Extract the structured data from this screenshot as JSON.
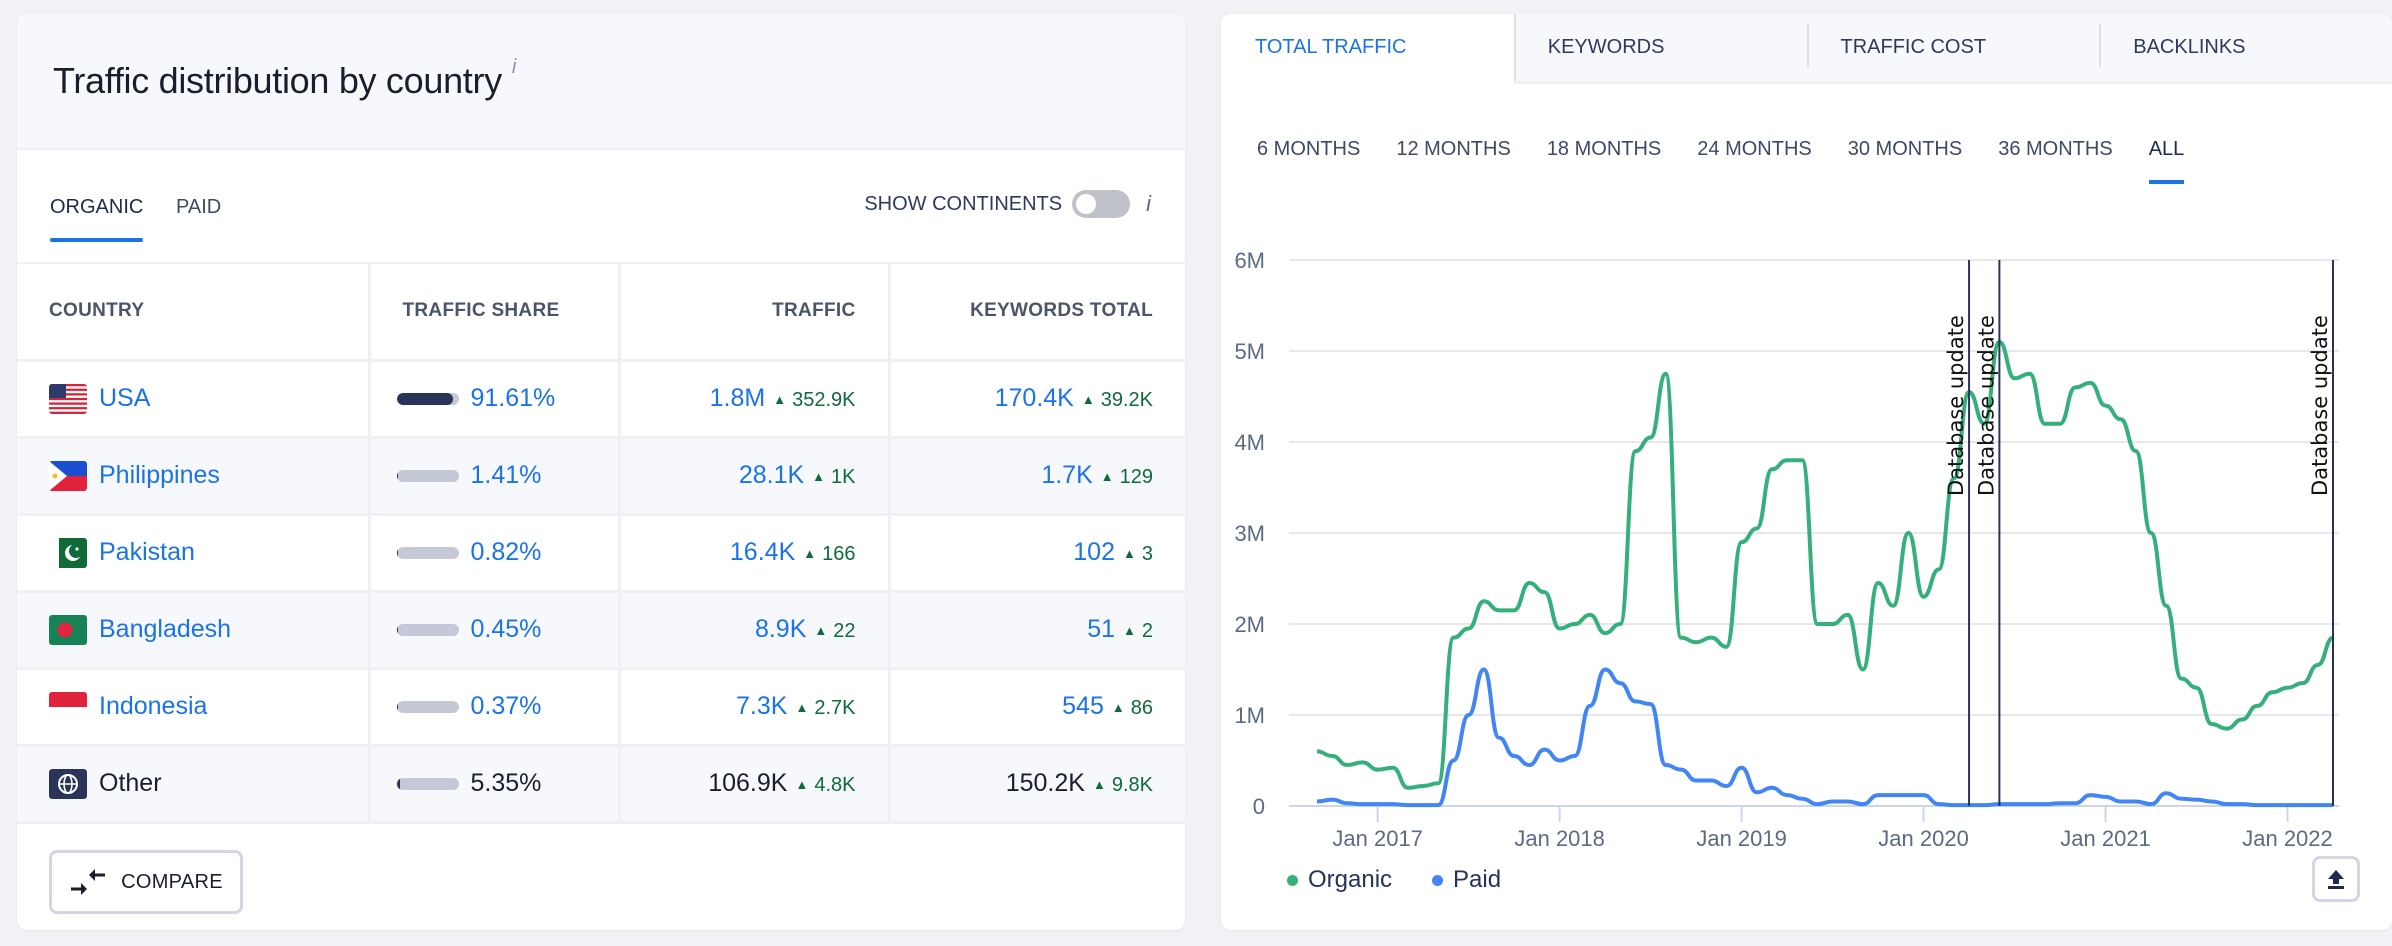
{
  "left_panel": {
    "title": "Traffic distribution by country",
    "info_glyph": "i",
    "tabs": [
      {
        "label": "ORGANIC",
        "active": true
      },
      {
        "label": "PAID",
        "active": false
      }
    ],
    "show_continents": {
      "label": "SHOW CONTINENTS",
      "enabled": false,
      "info_glyph": "i"
    },
    "columns": [
      "COUNTRY",
      "TRAFFIC SHARE",
      "TRAFFIC",
      "KEYWORDS TOTAL"
    ],
    "rows": [
      {
        "country": "USA",
        "flag": "us-flag-icon",
        "share": "91.61%",
        "share_value": 91.61,
        "traffic": "1.8M",
        "traffic_delta": "352.9K",
        "keywords": "170.4K",
        "keywords_delta": "39.2K",
        "link": true
      },
      {
        "country": "Philippines",
        "flag": "ph-flag-icon",
        "share": "1.41%",
        "share_value": 1.41,
        "traffic": "28.1K",
        "traffic_delta": "1K",
        "keywords": "1.7K",
        "keywords_delta": "129",
        "link": true
      },
      {
        "country": "Pakistan",
        "flag": "pk-flag-icon",
        "share": "0.82%",
        "share_value": 0.82,
        "traffic": "16.4K",
        "traffic_delta": "166",
        "keywords": "102",
        "keywords_delta": "3",
        "link": true
      },
      {
        "country": "Bangladesh",
        "flag": "bd-flag-icon",
        "share": "0.45%",
        "share_value": 0.45,
        "traffic": "8.9K",
        "traffic_delta": "22",
        "keywords": "51",
        "keywords_delta": "2",
        "link": true
      },
      {
        "country": "Indonesia",
        "flag": "id-flag-icon",
        "share": "0.37%",
        "share_value": 0.37,
        "traffic": "7.3K",
        "traffic_delta": "2.7K",
        "keywords": "545",
        "keywords_delta": "86",
        "link": true
      },
      {
        "country": "Other",
        "flag": "globe-icon",
        "share": "5.35%",
        "share_value": 5.35,
        "traffic": "106.9K",
        "traffic_delta": "4.8K",
        "keywords": "150.2K",
        "keywords_delta": "9.8K",
        "link": false
      }
    ],
    "delta_glyph": "▲",
    "compare_label": "COMPARE"
  },
  "right_panel": {
    "tabs": [
      {
        "label": "TOTAL TRAFFIC",
        "active": true
      },
      {
        "label": "KEYWORDS",
        "active": false
      },
      {
        "label": "TRAFFIC COST",
        "active": false
      },
      {
        "label": "BACKLINKS",
        "active": false
      }
    ],
    "periods": [
      {
        "label": "6 MONTHS",
        "active": false
      },
      {
        "label": "12 MONTHS",
        "active": false
      },
      {
        "label": "18 MONTHS",
        "active": false
      },
      {
        "label": "24 MONTHS",
        "active": false
      },
      {
        "label": "30 MONTHS",
        "active": false
      },
      {
        "label": "36 MONTHS",
        "active": false
      },
      {
        "label": "ALL",
        "active": true
      }
    ],
    "export_icon": "export-icon"
  },
  "colors": {
    "organic": "#35b07a",
    "paid": "#4285f4",
    "accent": "#1a73e8",
    "delta_up": "#0d6b3c",
    "annotation": "#2a3358"
  },
  "chart_data": {
    "type": "line",
    "title": "",
    "xlabel": "",
    "ylabel": "",
    "start_month": "2016-09",
    "ylim": [
      0,
      6000000
    ],
    "yticks": [
      0,
      1000000,
      2000000,
      3000000,
      4000000,
      5000000,
      6000000
    ],
    "ytick_labels": [
      "0",
      "1M",
      "2M",
      "3M",
      "4M",
      "5M",
      "6M"
    ],
    "xticks": [
      "2017-01",
      "2018-01",
      "2019-01",
      "2020-01",
      "2021-01",
      "2022-01"
    ],
    "xtick_labels": [
      "Jan 2017",
      "Jan 2018",
      "Jan 2019",
      "Jan 2020",
      "Jan 2021",
      "Jan 2022"
    ],
    "grid": true,
    "legend_position": "bottom-left",
    "series": [
      {
        "name": "Organic",
        "unit": "millions",
        "values": [
          0.6,
          0.55,
          0.45,
          0.48,
          0.4,
          0.42,
          0.2,
          0.22,
          0.25,
          1.85,
          1.95,
          2.25,
          2.15,
          2.15,
          2.45,
          2.35,
          1.95,
          2.0,
          2.1,
          1.9,
          2.0,
          3.9,
          4.05,
          4.75,
          1.85,
          1.8,
          1.85,
          1.75,
          2.9,
          3.05,
          3.7,
          3.8,
          3.8,
          2.0,
          2.0,
          2.1,
          1.5,
          2.45,
          2.2,
          3.0,
          2.3,
          2.6,
          3.6,
          4.55,
          4.2,
          5.1,
          4.7,
          4.75,
          4.2,
          4.2,
          4.6,
          4.65,
          4.4,
          4.25,
          3.9,
          3.0,
          2.2,
          1.4,
          1.3,
          0.9,
          0.85,
          0.95,
          1.1,
          1.25,
          1.3,
          1.35,
          1.55,
          1.85
        ]
      },
      {
        "name": "Paid",
        "unit": "millions",
        "values": [
          0.05,
          0.07,
          0.03,
          0.02,
          0.02,
          0.02,
          0.01,
          0.01,
          0.01,
          0.5,
          1.0,
          1.5,
          0.75,
          0.55,
          0.45,
          0.62,
          0.5,
          0.55,
          1.1,
          1.5,
          1.35,
          1.15,
          1.12,
          0.45,
          0.4,
          0.28,
          0.28,
          0.22,
          0.42,
          0.15,
          0.2,
          0.12,
          0.08,
          0.02,
          0.05,
          0.05,
          0.02,
          0.12,
          0.12,
          0.12,
          0.12,
          0.02,
          0.01,
          0.01,
          0.01,
          0.02,
          0.02,
          0.02,
          0.02,
          0.03,
          0.03,
          0.12,
          0.1,
          0.05,
          0.05,
          0.02,
          0.14,
          0.08,
          0.07,
          0.05,
          0.02,
          0.02,
          0.01,
          0.01,
          0.01,
          0.01,
          0.01,
          0.01
        ]
      }
    ],
    "annotations": [
      {
        "month": "2020-04",
        "label": "Database update"
      },
      {
        "month": "2020-06",
        "label": "Database update"
      },
      {
        "month": "2022-04",
        "label": "Database update"
      }
    ]
  }
}
